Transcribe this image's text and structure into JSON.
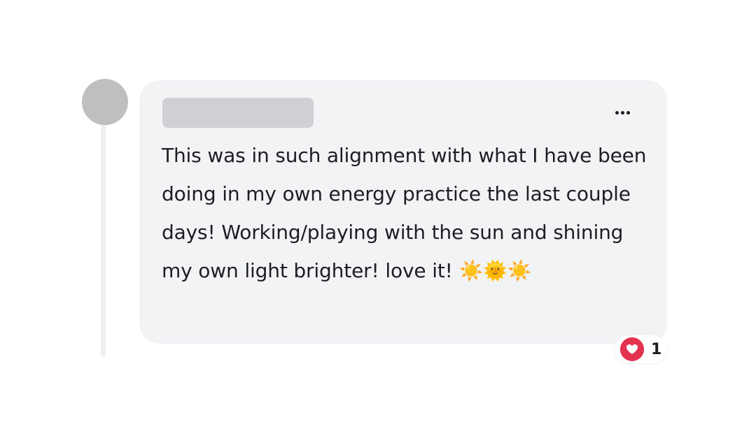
{
  "comment": {
    "text": "This was in such alignment with what I have been doing in my own energy practice the last couple days! Working/playing with the sun and shining my own light brighter! love it! ☀️🌞☀️",
    "author_icon": "avatar-placeholder",
    "more_icon": "more-options-icon"
  },
  "reaction": {
    "icon": "love-heart-icon",
    "count": "1",
    "color": "#e4324f"
  },
  "colors": {
    "bubble": "#f2f3f5",
    "avatar": "#bfbfbf",
    "name_placeholder": "#ced0d4",
    "text": "#1c1e21"
  }
}
